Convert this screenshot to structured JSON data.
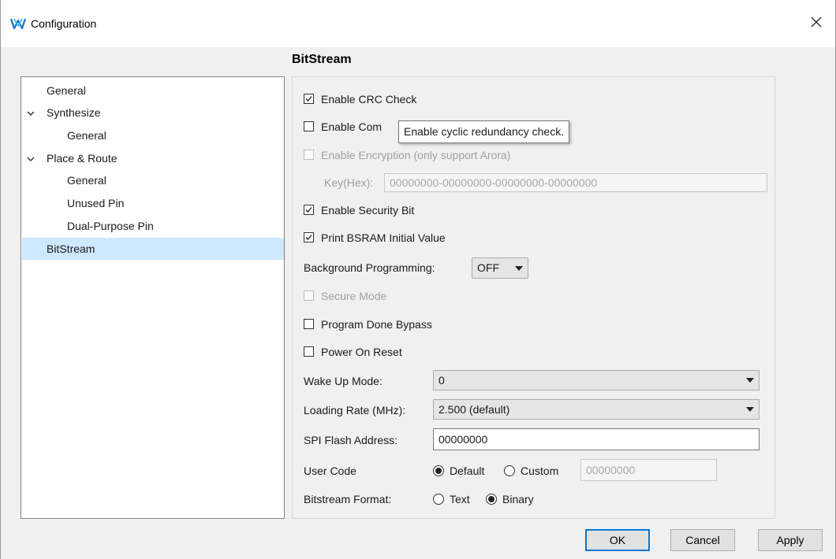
{
  "window": {
    "title": "Configuration"
  },
  "section_title": "BitStream",
  "tree": {
    "items": [
      {
        "label": "General"
      },
      {
        "label": "Synthesize"
      },
      {
        "label": "General"
      },
      {
        "label": "Place & Route"
      },
      {
        "label": "General"
      },
      {
        "label": "Unused Pin"
      },
      {
        "label": "Dual-Purpose Pin"
      },
      {
        "label": "BitStream"
      }
    ]
  },
  "options": {
    "crc": {
      "label": "Enable CRC Check",
      "checked": true
    },
    "compress": {
      "label": "Enable Com",
      "checked": false
    },
    "tooltip": "Enable cyclic redundancy check.",
    "encryption": {
      "label": "Enable Encryption (only support Arora)",
      "checked": false,
      "enabled": false
    },
    "key": {
      "label": "Key(Hex):",
      "placeholder": "00000000-00000000-00000000-00000000"
    },
    "security_bit": {
      "label": "Enable Security Bit",
      "checked": true
    },
    "bsram": {
      "label": "Print BSRAM Initial Value",
      "checked": true
    },
    "bg_prog": {
      "label": "Background Programming:",
      "value": "OFF"
    },
    "secure_mode": {
      "label": "Secure Mode",
      "checked": false,
      "enabled": false
    },
    "prog_done": {
      "label": "Program Done Bypass",
      "checked": false
    },
    "power_on": {
      "label": "Power On Reset",
      "checked": false
    },
    "wake_up": {
      "label": "Wake Up Mode:",
      "value": "0"
    },
    "loading_rate": {
      "label": "Loading Rate (MHz):",
      "value": "2.500 (default)"
    },
    "spi": {
      "label": "SPI Flash Address:",
      "value": "00000000"
    },
    "user_code": {
      "label": "User Code",
      "default_label": "Default",
      "custom_label": "Custom",
      "custom_value": "00000000",
      "selected": "Default"
    },
    "format": {
      "label": "Bitstream Format:",
      "text_label": "Text",
      "binary_label": "Binary",
      "selected": "Binary"
    }
  },
  "buttons": {
    "ok": "OK",
    "cancel": "Cancel",
    "apply": "Apply"
  },
  "colors": {
    "selection": "#cde8ff",
    "accent": "#0078d7"
  }
}
